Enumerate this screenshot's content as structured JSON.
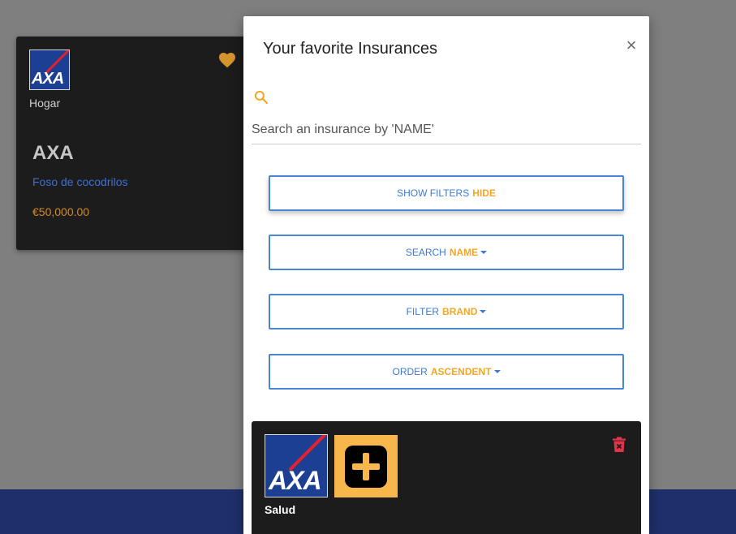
{
  "background": {
    "card": {
      "logo_text": "AXA",
      "category": "Hogar",
      "name": "AXA",
      "location": "Foso de cocodrilos",
      "price": "€50,000.00",
      "favorite_icon": "heart-icon"
    }
  },
  "modal": {
    "title": "Your favorite Insurances",
    "close_label": "×",
    "search": {
      "icon": "search-icon",
      "placeholder": "Search an insurance by 'NAME'",
      "value": ""
    },
    "buttons": {
      "filters": {
        "label": "SHOW FILTERS",
        "accent": "HIDE"
      },
      "search_by": {
        "label": "SEARCH",
        "accent": "NAME"
      },
      "filter_by": {
        "label": "FILTER",
        "accent": "BRAND"
      },
      "order_by": {
        "label": "ORDER",
        "accent": "ASCENDENT"
      }
    },
    "items": [
      {
        "logo_text": "AXA",
        "badge_icon": "plus-icon",
        "category": "Salud",
        "delete_icon": "trash-icon"
      }
    ]
  },
  "colors": {
    "accent": "#f5a623",
    "primary": "#3a7bd5",
    "axa_blue": "#1c3f94",
    "axa_red": "#e3222b",
    "delete": "#e0344a"
  }
}
